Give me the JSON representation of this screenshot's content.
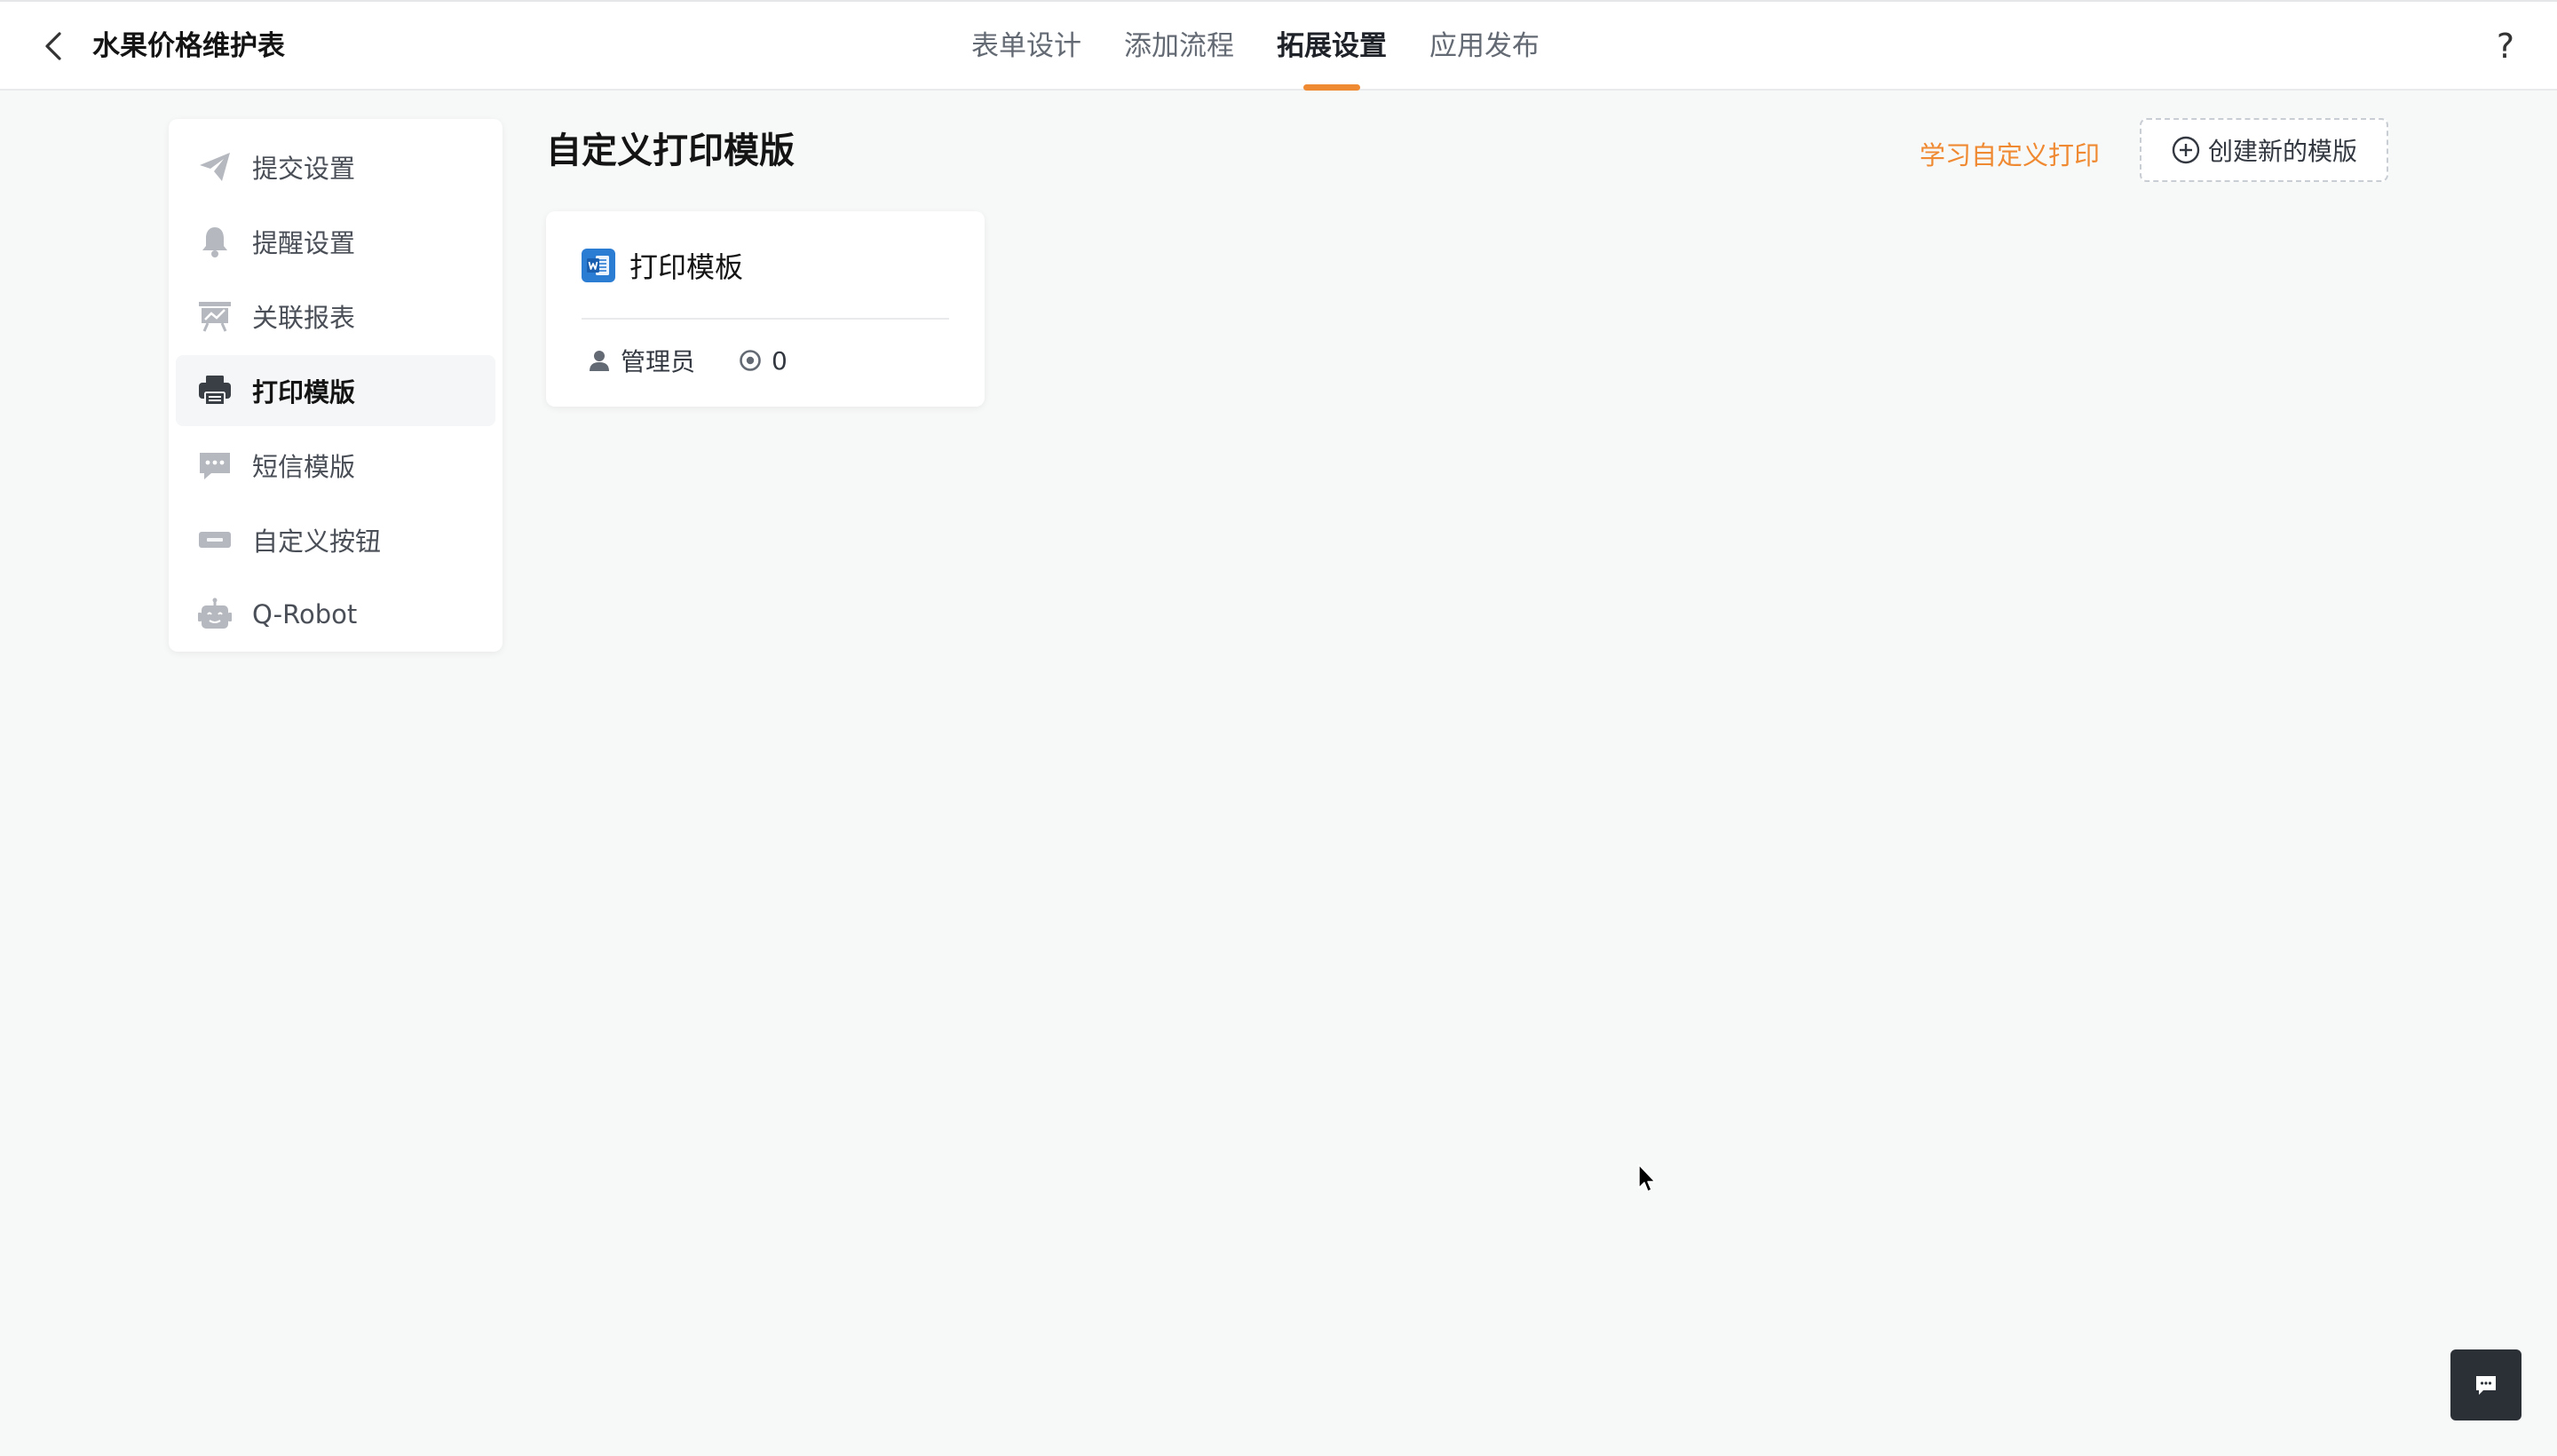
{
  "header": {
    "back_icon": "chevron-left-icon",
    "app_title": "水果价格维护表",
    "tabs": [
      {
        "label": "表单设计",
        "active": false
      },
      {
        "label": "添加流程",
        "active": false
      },
      {
        "label": "拓展设置",
        "active": true
      },
      {
        "label": "应用发布",
        "active": false
      }
    ],
    "help_icon": "question-mark-icon",
    "help_label": "?"
  },
  "sidebar": {
    "items": [
      {
        "label": "提交设置",
        "icon": "paper-plane-icon",
        "active": false
      },
      {
        "label": "提醒设置",
        "icon": "bell-icon",
        "active": false
      },
      {
        "label": "关联报表",
        "icon": "presentation-chart-icon",
        "active": false
      },
      {
        "label": "打印模版",
        "icon": "printer-icon",
        "active": true
      },
      {
        "label": "短信模版",
        "icon": "message-bubble-icon",
        "active": false
      },
      {
        "label": "自定义按钮",
        "icon": "btn-icon",
        "active": false
      },
      {
        "label": "Q-Robot",
        "icon": "robot-icon",
        "active": false
      }
    ]
  },
  "main": {
    "title": "自定义打印模版",
    "learn_link": "学习自定义打印",
    "create_button": "创建新的模版",
    "templates": [
      {
        "title": "打印模板",
        "icon": "word-document-icon",
        "owner": "管理员",
        "count": "0"
      }
    ]
  },
  "colors": {
    "accent": "#f08a32",
    "background": "#f7f8f8",
    "card": "#ffffff",
    "word_blue": "#2b7cd3",
    "chat_button": "#2b2f36"
  },
  "floating": {
    "chat_icon": "chat-bubble-icon"
  }
}
